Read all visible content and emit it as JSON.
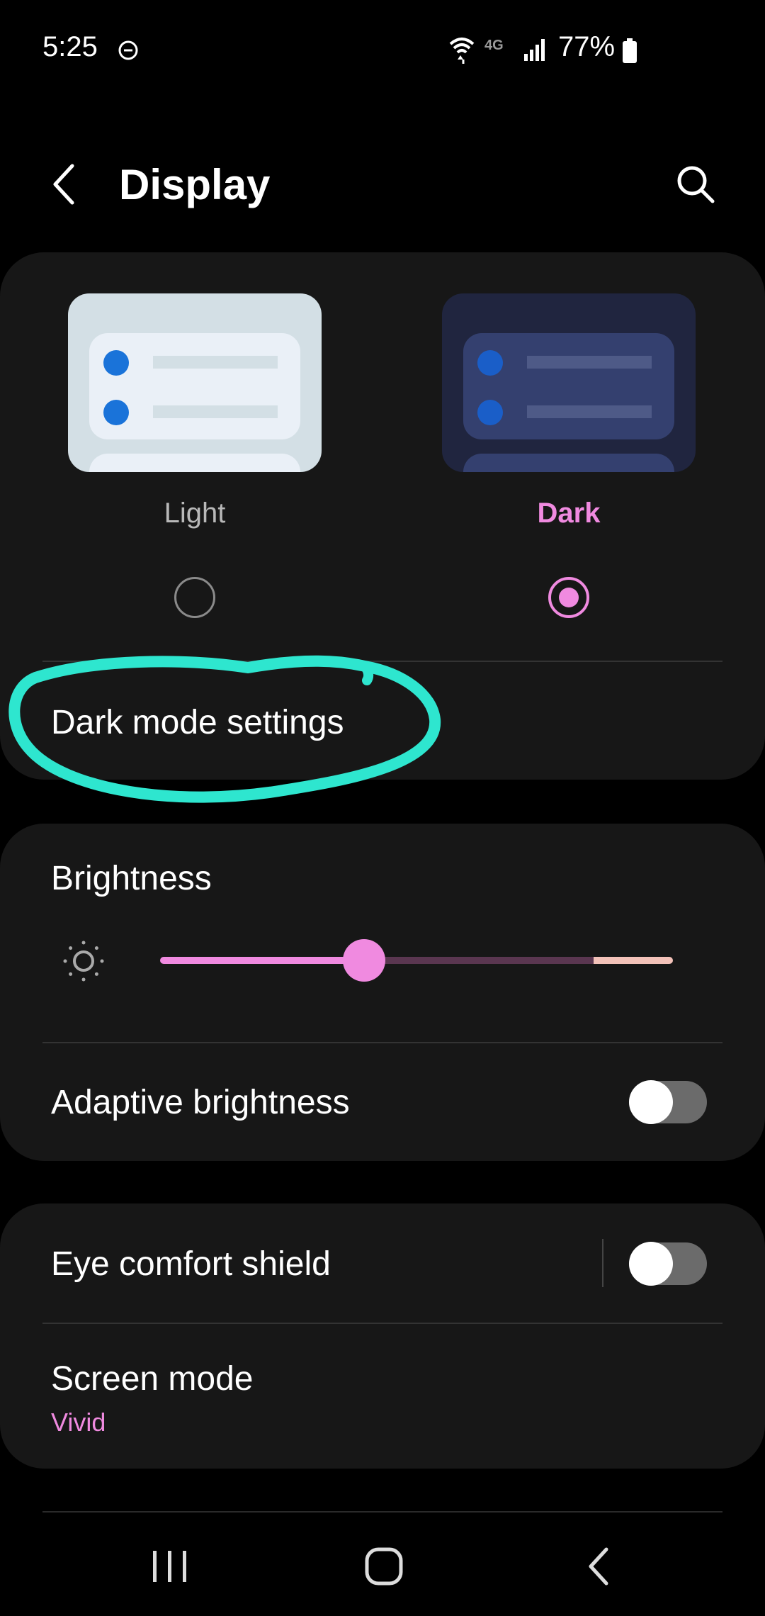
{
  "status_bar": {
    "time": "5:25",
    "network": "4G",
    "battery": "77%",
    "icons": [
      "do-not-disturb-icon",
      "wifi-icon",
      "lte-icon",
      "signal-icon",
      "battery-icon"
    ]
  },
  "header": {
    "title": "Display",
    "icons": [
      "back-arrow-icon",
      "search-icon"
    ]
  },
  "theme": {
    "light_label": "Light",
    "dark_label": "Dark",
    "selected": "Dark"
  },
  "dark_mode_settings": {
    "label": "Dark mode settings"
  },
  "brightness": {
    "label": "Brightness",
    "level": 0.4
  },
  "adaptive_brightness": {
    "label": "Adaptive brightness",
    "enabled": false
  },
  "eye_comfort": {
    "label": "Eye comfort shield",
    "enabled": false
  },
  "screen_mode": {
    "label": "Screen mode",
    "value": "Vivid"
  },
  "nav": {
    "icons": [
      "recents-icon",
      "home-icon",
      "nav-back-icon"
    ]
  },
  "colors": {
    "accent": "#f08ae0",
    "card": "#171717",
    "annotation": "#2ee6cf"
  }
}
